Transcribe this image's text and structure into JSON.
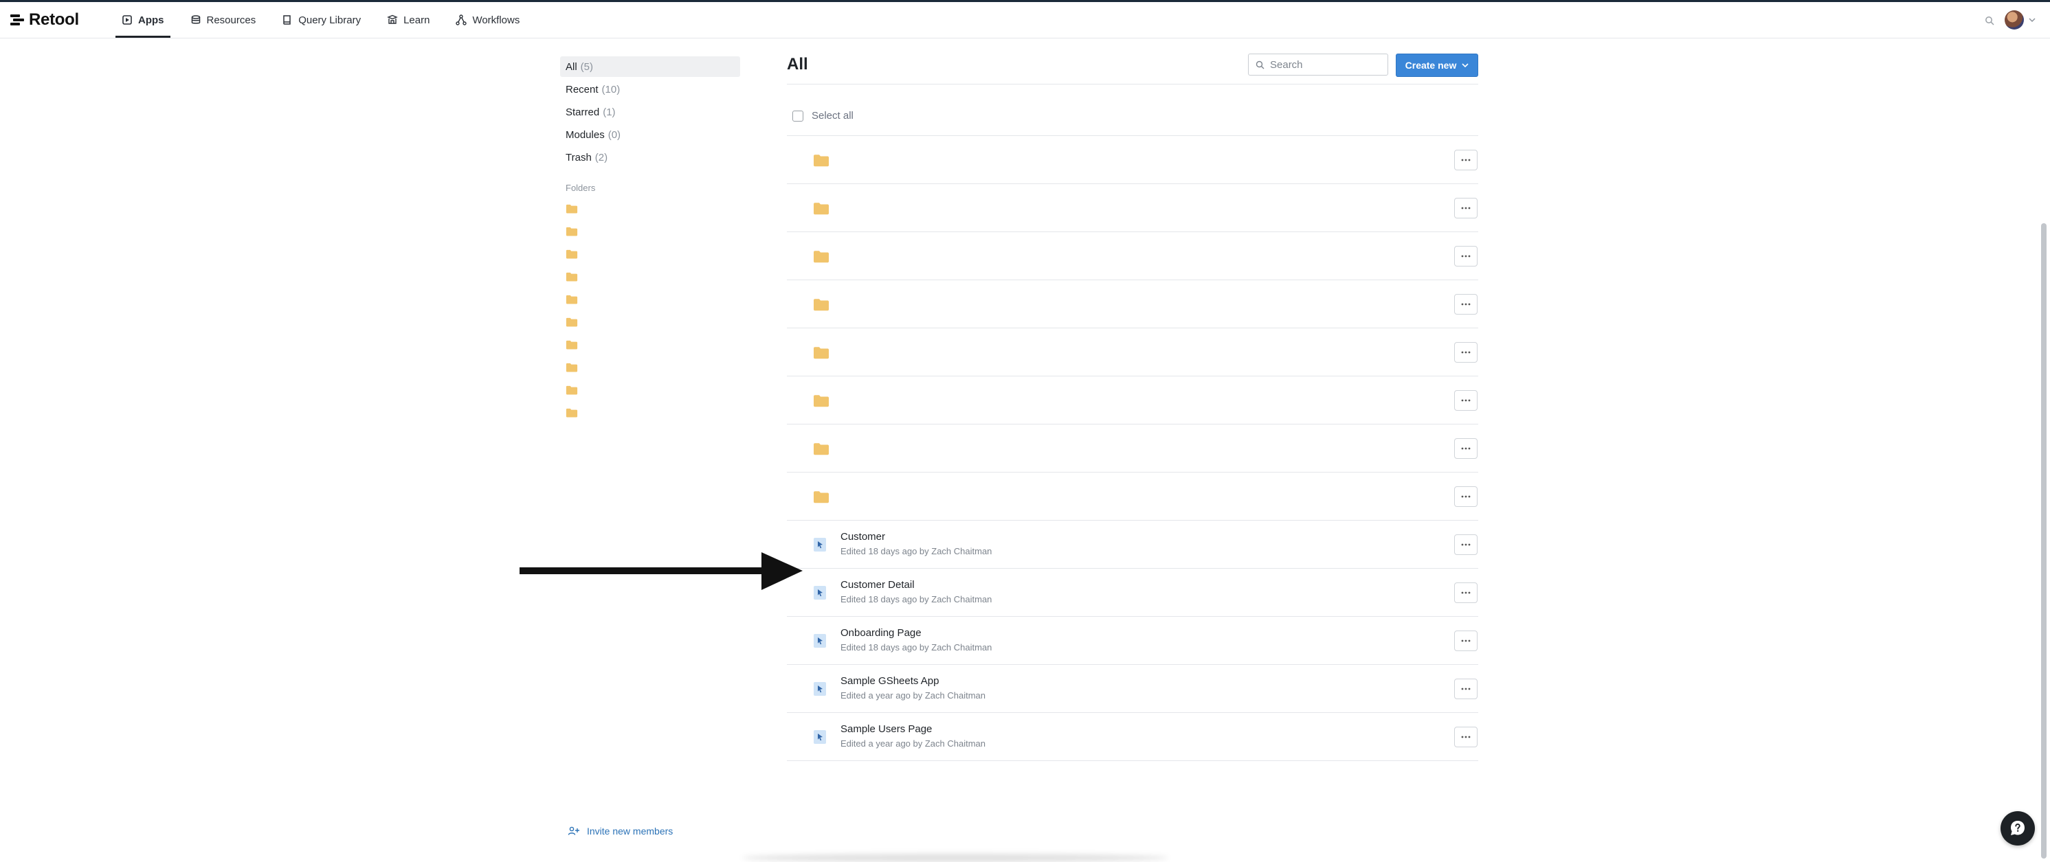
{
  "app": {
    "name": "Retool"
  },
  "nav": [
    {
      "label": "Apps",
      "icon": "apps-icon",
      "active": true
    },
    {
      "label": "Resources",
      "icon": "database-icon",
      "active": false
    },
    {
      "label": "Query Library",
      "icon": "book-icon",
      "active": false
    },
    {
      "label": "Learn",
      "icon": "school-icon",
      "active": false
    },
    {
      "label": "Workflows",
      "icon": "workflow-icon",
      "active": false
    }
  ],
  "sidebar": {
    "items": [
      {
        "label": "All",
        "count": "(5)",
        "active": true
      },
      {
        "label": "Recent",
        "count": "(10)",
        "active": false
      },
      {
        "label": "Starred",
        "count": "(1)",
        "active": false
      },
      {
        "label": "Modules",
        "count": "(0)",
        "active": false
      },
      {
        "label": "Trash",
        "count": "(2)",
        "active": false
      }
    ],
    "folders_label": "Folders",
    "folder_count": 10
  },
  "main": {
    "title": "All",
    "search_placeholder": "Search",
    "create_label": "Create new",
    "select_all_label": "Select all",
    "folders": [
      {},
      {},
      {},
      {},
      {},
      {},
      {},
      {}
    ],
    "apps": [
      {
        "name": "Customer",
        "meta": "Edited 18 days ago by Zach Chaitman"
      },
      {
        "name": "Customer Detail",
        "meta": "Edited 18 days ago by Zach Chaitman"
      },
      {
        "name": "Onboarding Page",
        "meta": "Edited 18 days ago by Zach Chaitman"
      },
      {
        "name": "Sample GSheets App",
        "meta": "Edited a year ago by Zach Chaitman"
      },
      {
        "name": "Sample Users Page",
        "meta": "Edited a year ago by Zach Chaitman"
      }
    ]
  },
  "footer": {
    "invite_label": "Invite new members"
  },
  "colors": {
    "accent": "#3a86d8",
    "folder": "#f1c46b",
    "app_icon": "#cfe3f7",
    "link": "#2c73b7"
  }
}
